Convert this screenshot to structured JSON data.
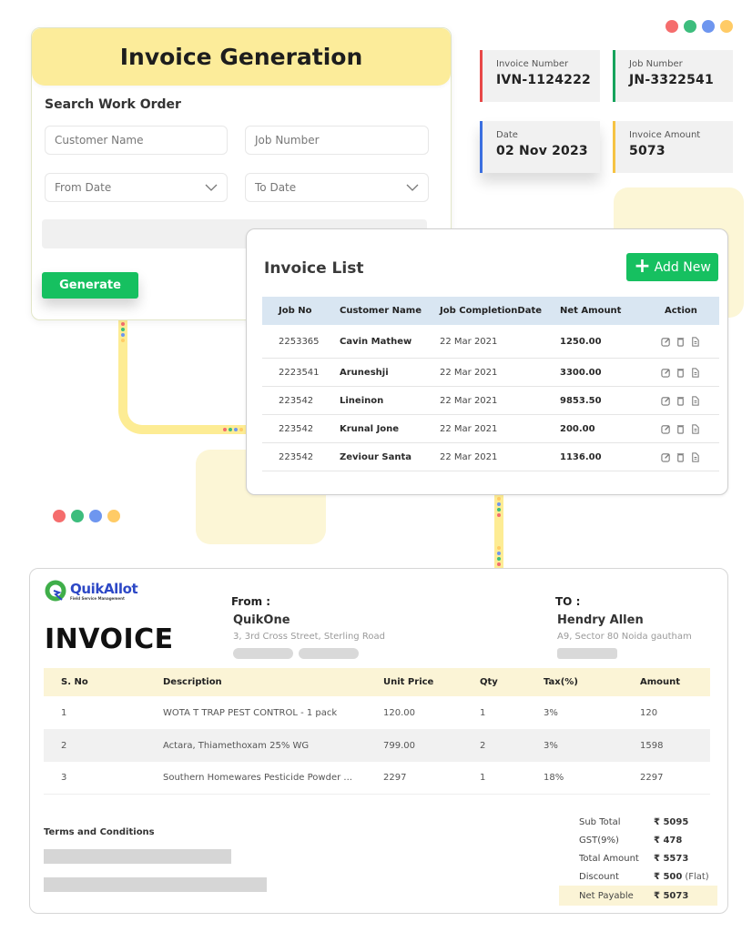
{
  "invoice_generation": {
    "title": "Invoice Generation",
    "section_title": "Search Work Order",
    "fields": {
      "customer_name_placeholder": "Customer Name",
      "job_number_placeholder": "Job Number",
      "from_date_placeholder": "From Date",
      "to_date_placeholder": "To Date"
    },
    "generate_label": "Generate"
  },
  "stats": [
    {
      "label": "Invoice Number",
      "value": "IVN-1124222",
      "accent": "#e84848"
    },
    {
      "label": "Job Number",
      "value": "JN-3322541",
      "accent": "#16a35c"
    },
    {
      "label": "Date",
      "value": "02 Nov 2023",
      "accent": "#3b6fe0"
    },
    {
      "label": "Invoice Amount",
      "value": "5073",
      "accent": "#f6c343"
    }
  ],
  "decor_dot_colors": [
    "#f56d6d",
    "#3dbd7d",
    "#6e96ef",
    "#ffcb66"
  ],
  "invoice_list": {
    "title": "Invoice List",
    "add_new_label": "Add New",
    "columns": [
      "Job No",
      "Customer Name",
      "Job CompletionDate",
      "Net Amount",
      "Action"
    ],
    "rows": [
      {
        "job_no": "2253365",
        "customer": "Cavin Mathew",
        "date": "22 Mar 2021",
        "amount": "1250.00"
      },
      {
        "job_no": "2223541",
        "customer": "Aruneshji",
        "date": "22 Mar 2021",
        "amount": "3300.00"
      },
      {
        "job_no": "223542",
        "customer": "Lineinon",
        "date": "22 Mar 2021",
        "amount": "9853.50"
      },
      {
        "job_no": "223542",
        "customer": "Krunal Jone",
        "date": "22 Mar 2021",
        "amount": "200.00"
      },
      {
        "job_no": "223542",
        "customer": "Zeviour Santa",
        "date": "22 Mar 2021",
        "amount": "1136.00"
      }
    ],
    "actions": [
      "edit-icon",
      "delete-icon",
      "document-icon"
    ]
  },
  "invoice": {
    "logo_name": "QuikAllot",
    "logo_tagline": "Field Service Management",
    "title": "INVOICE",
    "from": {
      "label": "From :",
      "name": "QuikOne",
      "address": "3, 3rd Cross Street, Sterling Road"
    },
    "to": {
      "label": "TO :",
      "name": "Hendry Allen",
      "address": "A9, Sector 80 Noida gautham"
    },
    "columns": [
      "S. No",
      "Description",
      "Unit Price",
      "Qty",
      "Tax(%)",
      "Amount"
    ],
    "items": [
      {
        "sno": "1",
        "description": "WOTA T TRAP PEST CONTROL - 1 pack",
        "unit_price": "120.00",
        "qty": "1",
        "tax": "3%",
        "amount": "120"
      },
      {
        "sno": "2",
        "description": "Actara, Thiamethoxam 25% WG",
        "unit_price": "799.00",
        "qty": "2",
        "tax": "3%",
        "amount": "1598"
      },
      {
        "sno": "3",
        "description": "Southern Homewares Pesticide Powder ...",
        "unit_price": "2297",
        "qty": "1",
        "tax": "18%",
        "amount": "2297"
      }
    ],
    "terms_label": "Terms and Conditions",
    "totals": [
      {
        "label": "Sub Total",
        "value": "₹ 5095",
        "note": ""
      },
      {
        "label": "GST(9%)",
        "value": "₹ 478",
        "note": ""
      },
      {
        "label": "Total Amount",
        "value": "₹ 5573",
        "note": ""
      },
      {
        "label": "Discount",
        "value": "₹ 500",
        "note": "(Flat)"
      },
      {
        "label": "Net Payable",
        "value": "₹ 5073",
        "note": ""
      }
    ]
  }
}
